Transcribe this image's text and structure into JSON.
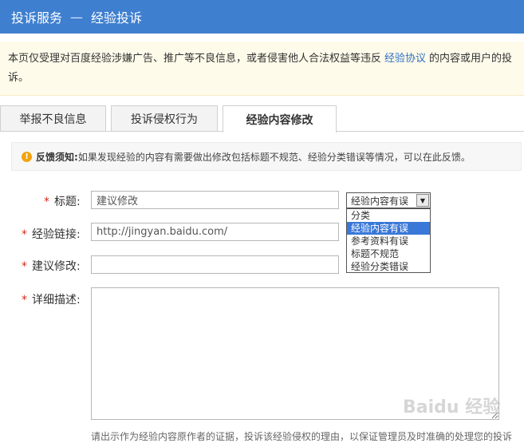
{
  "header": {
    "title": "投诉服务",
    "separator": "—",
    "crumb": "经验投诉"
  },
  "notice": {
    "text_before": "本页仅受理对百度经验涉嫌广告、推广等不良信息，或者侵害他人合法权益等违反",
    "link": "经验协议",
    "text_after": "的内容或用户的投诉。"
  },
  "tabs": [
    {
      "label": "举报不良信息",
      "active": false
    },
    {
      "label": "投诉侵权行为",
      "active": false
    },
    {
      "label": "经验内容修改",
      "active": true
    }
  ],
  "feedback": {
    "icon": "warning-icon",
    "label": "反馈须知:",
    "text": "如果发现经验的内容有需要做出修改包括标题不规范、经验分类错误等情况，可以在此反馈。"
  },
  "form": {
    "required_mark": "*",
    "title_label": "标题:",
    "title_value": "建议修改",
    "link_label": "经验链接:",
    "link_value": "http://jingyan.baidu.com/",
    "suggest_label": "建议修改:",
    "suggest_value": "",
    "detail_label": "详细描述:",
    "detail_value": "",
    "category_selected": "经验内容有误",
    "category_options": [
      "分类",
      "经验内容有误",
      "参考资料有误",
      "标题不规范",
      "经验分类错误"
    ],
    "hint": "请出示作为经验内容原作者的证据，投诉该经验侵权的理由，以保证管理员及时准确的处理您的投诉"
  },
  "watermark": "Baidu 经验",
  "colors": {
    "header_bg": "#3f7fcf",
    "required": "#d02a1a",
    "link": "#2f6fc4",
    "selected_option": "#3a78d8"
  }
}
